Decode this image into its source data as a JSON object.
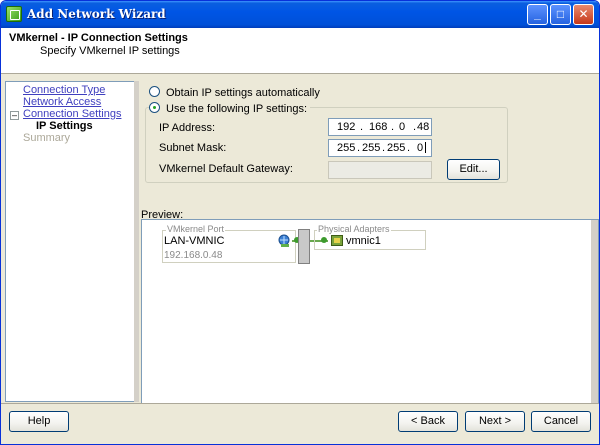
{
  "window": {
    "title": "Add Network Wizard",
    "minimize_glyph": "_",
    "maximize_glyph": "□",
    "close_glyph": "✕"
  },
  "header": {
    "title": "VMkernel - IP Connection Settings",
    "subtitle": "Specify VMkernel IP settings"
  },
  "nav": {
    "items": [
      {
        "label": "Connection Type",
        "state": "link"
      },
      {
        "label": "Network Access",
        "state": "link"
      },
      {
        "label": "Connection Settings",
        "state": "link"
      },
      {
        "label": "IP Settings",
        "state": "current"
      },
      {
        "label": "Summary",
        "state": "disabled"
      }
    ],
    "collapse_glyph": "–"
  },
  "ip_options": {
    "auto_label": "Obtain IP settings automatically",
    "manual_label": "Use the following IP settings:",
    "selected": "manual"
  },
  "fields": {
    "ip_label": "IP Address:",
    "ip_octets": [
      "192",
      "168",
      "0",
      "48"
    ],
    "mask_label": "Subnet Mask:",
    "mask_octets": [
      "255",
      "255",
      "255",
      "0"
    ],
    "gateway_label": "VMkernel Default Gateway:",
    "separator": "."
  },
  "edit_button": "Edit...",
  "preview": {
    "label": "Preview:",
    "vmkernel_port_legend": "VMkernel Port",
    "port_name": "LAN-VMNIC",
    "port_ip": "192.168.0.48",
    "adapters_legend": "Physical Adapters",
    "adapter_name": "vmnic1"
  },
  "buttons": {
    "help": "Help",
    "back": "< Back",
    "next": "Next >",
    "cancel": "Cancel"
  }
}
